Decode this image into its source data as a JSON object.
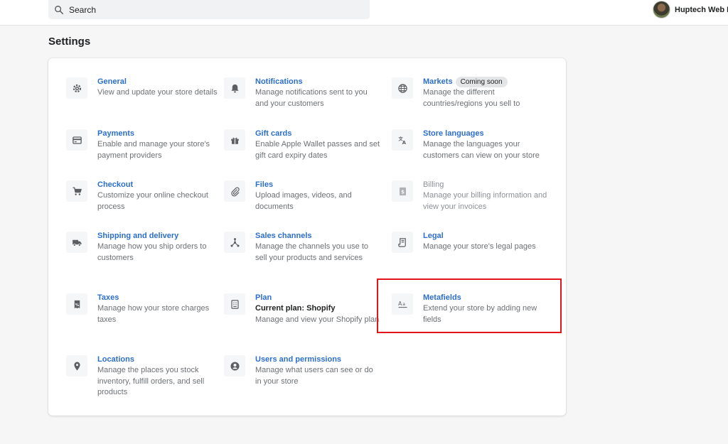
{
  "topbar": {
    "search_placeholder": "Search",
    "user_name": "Huptech Web I"
  },
  "page": {
    "title": "Settings"
  },
  "items": [
    {
      "id": "general",
      "title": "General",
      "desc": "View and update your store details",
      "icon": "gear-icon"
    },
    {
      "id": "notifications",
      "title": "Notifications",
      "desc": "Manage notifications sent to you and your customers",
      "icon": "bell-icon"
    },
    {
      "id": "markets",
      "title": "Markets",
      "badge": "Coming soon",
      "desc": "Manage the different countries/regions you sell to",
      "icon": "globe-icon"
    },
    {
      "id": "payments",
      "title": "Payments",
      "desc": "Enable and manage your store's payment providers",
      "icon": "credit-card-icon"
    },
    {
      "id": "gift-cards",
      "title": "Gift cards",
      "desc": "Enable Apple Wallet passes and set gift card expiry dates",
      "icon": "gift-icon"
    },
    {
      "id": "store-languages",
      "title": "Store languages",
      "desc": "Manage the languages your customers can view on your store",
      "icon": "translate-icon"
    },
    {
      "id": "checkout",
      "title": "Checkout",
      "desc": "Customize your online checkout process",
      "icon": "cart-icon"
    },
    {
      "id": "files",
      "title": "Files",
      "desc": "Upload images, videos, and documents",
      "icon": "paperclip-icon"
    },
    {
      "id": "billing",
      "title": "Billing",
      "desc": "Manage your billing information and view your invoices",
      "icon": "dollar-icon"
    },
    {
      "id": "shipping",
      "title": "Shipping and delivery",
      "desc": "Manage how you ship orders to customers",
      "icon": "truck-icon"
    },
    {
      "id": "sales-channels",
      "title": "Sales channels",
      "desc": "Manage the channels you use to sell your products and services",
      "icon": "channels-icon"
    },
    {
      "id": "legal",
      "title": "Legal",
      "desc": "Manage your store's legal pages",
      "icon": "document-icon"
    },
    {
      "id": "taxes",
      "title": "Taxes",
      "desc": "Manage how your store charges taxes",
      "icon": "percent-receipt-icon"
    },
    {
      "id": "plan",
      "title": "Plan",
      "subtitle": "Current plan: Shopify",
      "desc": "Manage and view your Shopify plan",
      "icon": "plan-icon"
    },
    {
      "id": "metafields",
      "title": "Metafields",
      "desc": "Extend your store by adding new fields",
      "icon": "metafields-icon"
    },
    {
      "id": "locations",
      "title": "Locations",
      "desc": "Manage the places you stock inventory, fulfill orders, and sell products",
      "icon": "location-pin-icon"
    },
    {
      "id": "users",
      "title": "Users and permissions",
      "desc": "Manage what users can see or do in your store",
      "icon": "user-circle-icon"
    }
  ],
  "colors": {
    "link": "#2c6ecb",
    "highlight_box": "#e3141b",
    "icon": "#5c5f62"
  }
}
